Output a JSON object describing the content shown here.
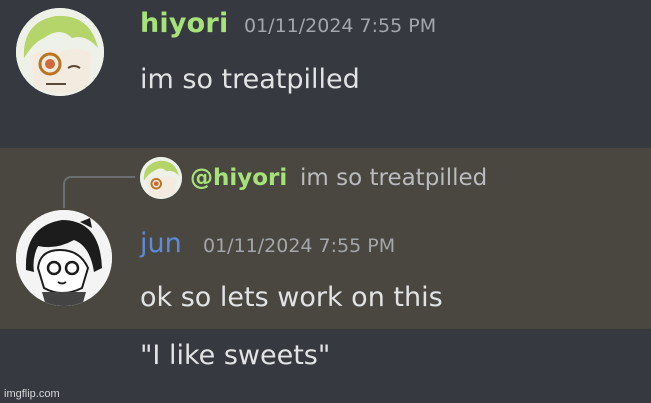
{
  "message1": {
    "username": "hiyori",
    "timestamp": "01/11/2024 7:55 PM",
    "text": "im so treatpilled",
    "avatar_icon": "anime-boy-green-hair-avatar"
  },
  "reply": {
    "mention": "@hiyori",
    "text": "im so treatpilled",
    "avatar_icon": "anime-boy-green-hair-avatar-small"
  },
  "message2": {
    "username": "jun",
    "timestamp": "01/11/2024 7:55 PM",
    "text": "ok so lets work on this",
    "avatar_icon": "anime-girl-black-hair-avatar"
  },
  "message3": {
    "text": "\"I like sweets\""
  },
  "watermark": "imgflip.com",
  "colors": {
    "background": "#36393f",
    "highlight": "#49473f",
    "hiyori_name": "#a6e27a",
    "jun_name": "#5d8bd8"
  }
}
